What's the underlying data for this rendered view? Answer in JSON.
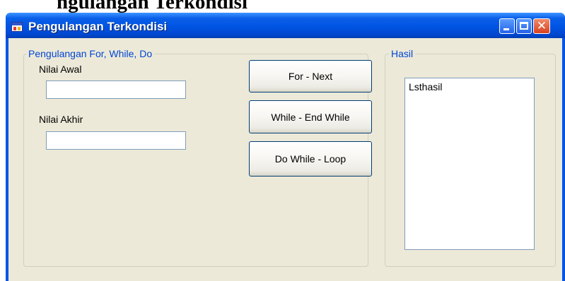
{
  "document": {
    "heading_fragment": "ngulangan Terkondisi"
  },
  "window": {
    "title": "Pengulangan Terkondisi",
    "controls": {
      "minimize": "minimize",
      "maximize": "maximize",
      "close": "✕"
    }
  },
  "group_loop": {
    "legend": "Pengulangan For, While, Do",
    "nilai_awal_label": "Nilai Awal",
    "nilai_awal_value": "",
    "nilai_akhir_label": "Nilai Akhir",
    "nilai_akhir_value": "",
    "buttons": {
      "for_next": "For - Next",
      "while_end_while": "While - End While",
      "do_while_loop": "Do While - Loop"
    }
  },
  "group_result": {
    "legend": "Hasil",
    "list_items": [
      "Lsthasil"
    ]
  },
  "icons": {
    "app": "app-form-icon",
    "minimize": "minimize-icon",
    "maximize": "maximize-icon",
    "close": "close-icon"
  },
  "colors": {
    "titlebar": "#0054e3",
    "legend_text": "#0046d5",
    "client_bg": "#ece9d8",
    "close_button": "#d8411f"
  }
}
